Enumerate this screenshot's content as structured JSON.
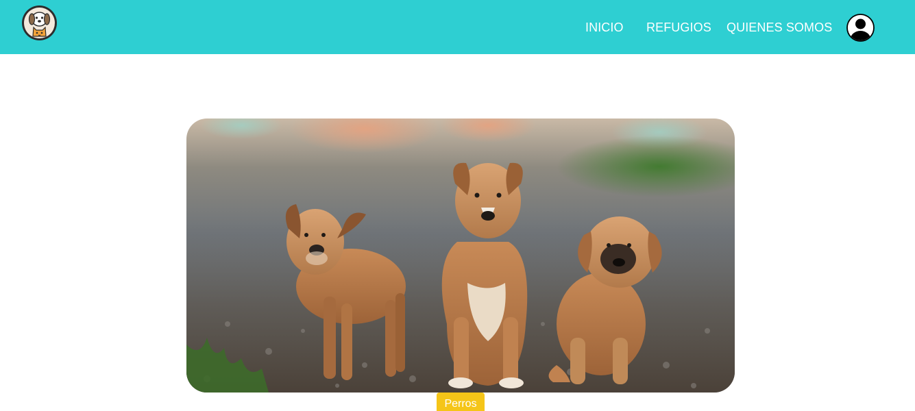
{
  "nav": {
    "logo_icon": "dog-cat-logo-icon",
    "links": [
      "INICIO",
      "REFUGIOS",
      "QUIENES SOMOS"
    ],
    "profile_icon": "user-profile-icon"
  },
  "hero": {
    "image_subject": "three-puppies-photo",
    "category_label": "Perros"
  },
  "colors": {
    "navbar": "#2ecfd2",
    "tag": "#f5c518",
    "text_light": "#ffffff"
  }
}
